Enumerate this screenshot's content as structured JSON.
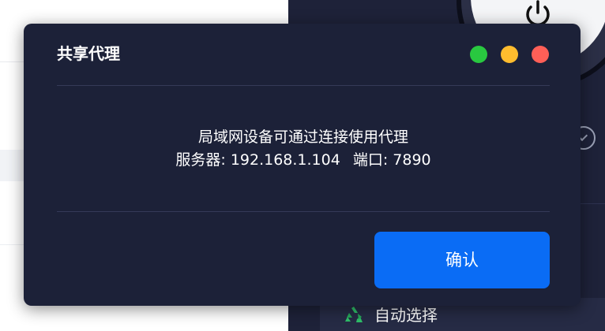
{
  "background": {
    "auto_select_label": "自动选择"
  },
  "dialog": {
    "title": "共享代理",
    "message_line1": "局域网设备可通过连接使用代理",
    "server_label": "服务器:",
    "server_value": "192.168.1.104",
    "port_label": "端口:",
    "port_value": "7890",
    "confirm_label": "确认"
  },
  "colors": {
    "dialog_bg": "#1c2138",
    "confirm_bg": "#0a6cf5",
    "dot_green": "#29c840",
    "dot_yellow": "#febc2e",
    "dot_red": "#ff5f57"
  }
}
